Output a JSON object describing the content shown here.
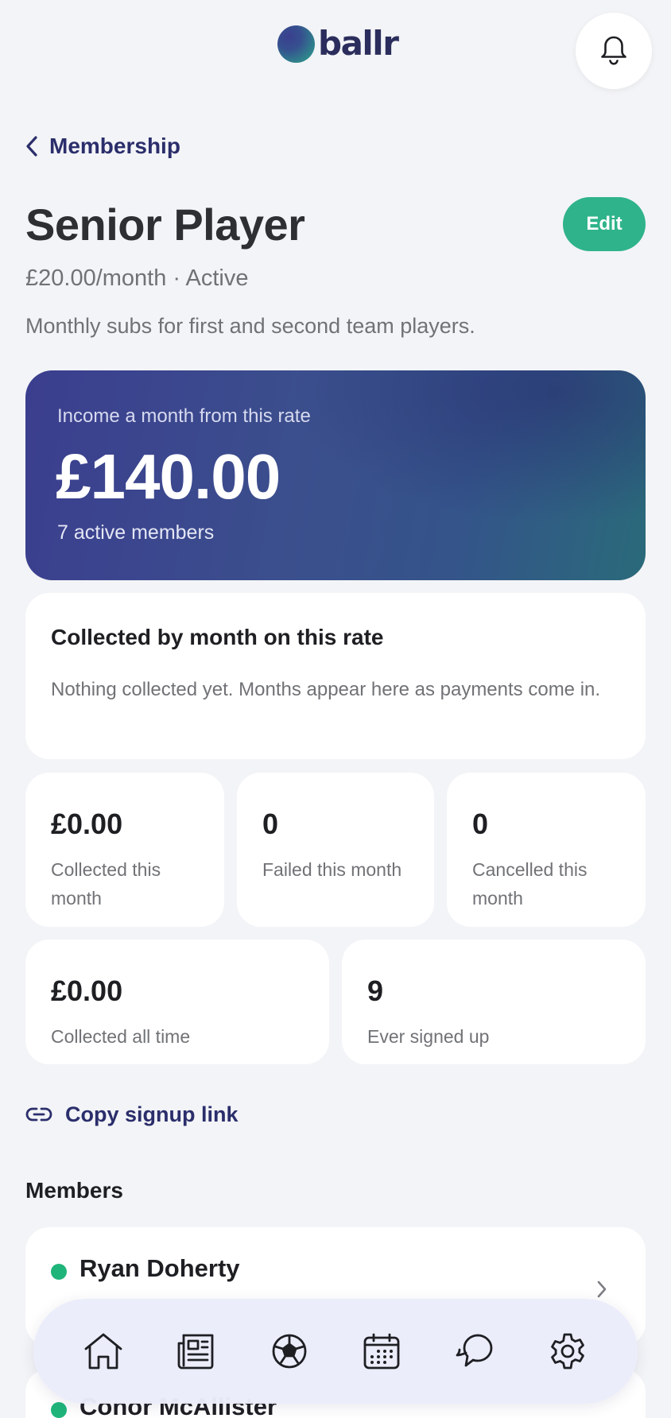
{
  "app": {
    "logo_text": "ballr"
  },
  "header": {
    "back_label": "Membership"
  },
  "rate": {
    "title": "Senior Player",
    "edit_label": "Edit",
    "price_line": "£20.00/month · Active",
    "description": "Monthly subs for first and second team players."
  },
  "hero": {
    "label": "Income a month from this rate",
    "amount": "£140.00",
    "sub": "7 active members"
  },
  "collected": {
    "title": "Collected by month on this rate",
    "text": "Nothing collected yet. Months appear here as payments come in."
  },
  "stats": [
    {
      "value": "£0.00",
      "label": "Collected this month"
    },
    {
      "value": "0",
      "label": "Failed this month"
    },
    {
      "value": "0",
      "label": "Cancelled this month"
    },
    {
      "value": "£0.00",
      "label": "Collected all time"
    },
    {
      "value": "9",
      "label": "Ever signed up"
    }
  ],
  "copy_link_label": "Copy signup link",
  "members": {
    "heading": "Members",
    "items": [
      {
        "name": "Ryan Doherty",
        "status_color": "#1fb47a"
      },
      {
        "name": "Conor McAllister",
        "status_color": "#1fb47a"
      }
    ]
  },
  "nav": {
    "items": [
      "home-icon",
      "news-icon",
      "football-icon",
      "calendar-icon",
      "chat-icon",
      "settings-icon"
    ]
  },
  "colors": {
    "accent": "#2fb38a",
    "navy": "#2b2e6b",
    "hero_start": "#3b3e8e",
    "hero_end": "#2a6a7a"
  }
}
